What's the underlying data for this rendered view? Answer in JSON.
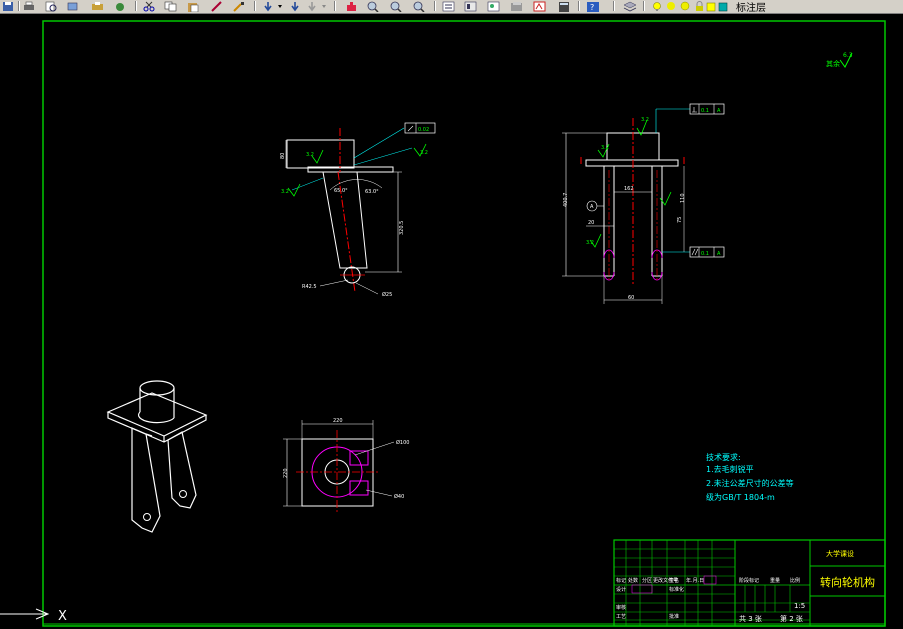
{
  "toolbar": {
    "layer_name": "标注层",
    "icons": [
      "save-icon",
      "print-icon",
      "print-preview-icon",
      "publish-icon",
      "plot-icon",
      "cut-icon",
      "copy-icon",
      "paste-icon",
      "match-properties-icon",
      "brush-icon",
      "undo-icon",
      "redo-icon",
      "pan-icon",
      "zoom-realtime-icon",
      "zoom-window-icon",
      "zoom-previous-icon",
      "properties-icon",
      "design-center-icon",
      "tool-palettes-icon",
      "sheet-set-icon",
      "markup-icon",
      "calculator-icon",
      "help-icon",
      "layer-manager-icon",
      "layer-on-icon",
      "layer-freeze-icon",
      "layer-lock-icon",
      "layer-color-icon"
    ]
  },
  "drawing": {
    "surface_roughness_note": "其余",
    "surface_roughness_value": "6.3",
    "view1": {
      "flatness_tol": "0.02",
      "angle_label": "65.0°",
      "angle_label2": "63.0°",
      "length_dim": "320.5",
      "radius_dim": "R42.5",
      "diameter_dim": "Ø25",
      "roughness1": "3.2",
      "roughness2": "3.2",
      "roughness3": "3.2",
      "height_dim": "80"
    },
    "view2": {
      "perp_tol": "0.1",
      "perp_datum": "A",
      "parallel_tol": "0.1",
      "parallel_datum": "A",
      "total_height": "400.7",
      "datum_label": "A",
      "inner_dim": "110",
      "width_dim": "60",
      "bore_dim": "162",
      "side_dim": "75",
      "gap_dim": "20",
      "roughness_top": "3.2",
      "roughness_left": "3.2",
      "roughness_mid": "3.2"
    },
    "view3": {
      "width_dim": "220",
      "height_dim": "220",
      "circle_dim": "Ø100",
      "hole_dim": "Ø40"
    }
  },
  "tech_req": {
    "title": "技术要求:",
    "line1": "1.去毛刺锐平",
    "line2": "2.未注公差尺寸的公差等",
    "line3": "级为GB/T 1804-m"
  },
  "title_block": {
    "school": "大学课设",
    "part_name": "转向轮机构",
    "scale": "1:5",
    "sheet_total": "共 3 张",
    "sheet_no": "第 2 张",
    "row_labels": [
      "标记",
      "处数",
      "分区",
      "更改文件号",
      "签名",
      "年.月.日"
    ],
    "design": "设计",
    "standard": "标准化",
    "audit": "审核",
    "process": "工艺",
    "approve": "批准",
    "stage": "阶段标记",
    "weight": "重量",
    "scale_label": "比例"
  },
  "ucs": {
    "x_label": "X"
  }
}
